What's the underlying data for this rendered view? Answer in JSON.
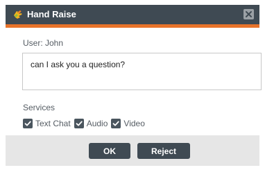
{
  "window": {
    "title": "Hand Raise",
    "icon": "raised-hand-icon",
    "close_icon": "close-icon",
    "colors": {
      "titlebar": "#3f4a53",
      "accent": "#e8732a",
      "footer": "#e6e6e6",
      "button": "#3f4a53"
    }
  },
  "user": {
    "label": "User: John"
  },
  "message": {
    "value": "can I ask you a question?"
  },
  "services": {
    "label": "Services",
    "items": [
      {
        "label": "Text Chat",
        "checked": true
      },
      {
        "label": "Audio",
        "checked": true
      },
      {
        "label": "Video",
        "checked": true
      }
    ]
  },
  "buttons": {
    "ok": "OK",
    "reject": "Reject"
  }
}
